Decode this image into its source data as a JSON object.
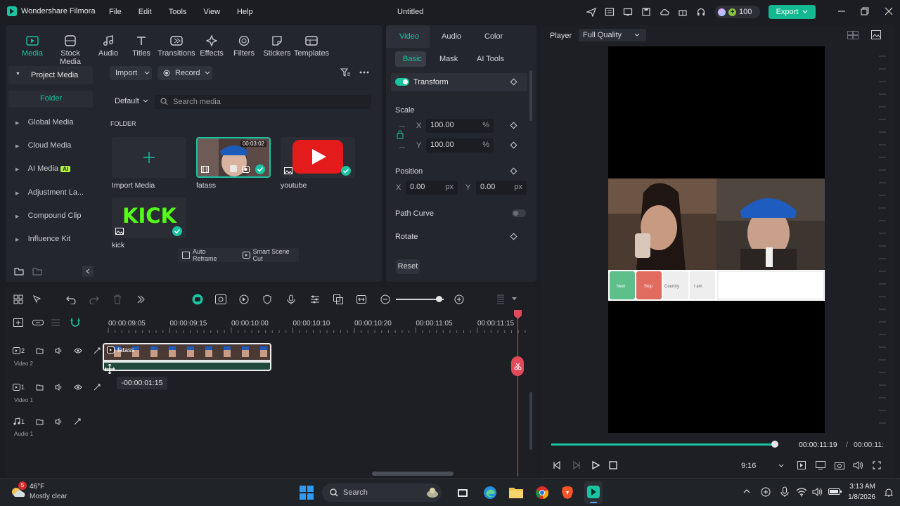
{
  "app": {
    "name": "Wondershare Filmora",
    "title": "Untitled"
  },
  "menu": [
    "File",
    "Edit",
    "Tools",
    "View",
    "Help"
  ],
  "titlebar": {
    "credits": "100",
    "export_label": "Export"
  },
  "toolbar": [
    "Media",
    "Stock Media",
    "Audio",
    "Titles",
    "Transitions",
    "Effects",
    "Filters",
    "Stickers",
    "Templates"
  ],
  "sidebar": {
    "project_media": "Project Media",
    "folder": "Folder",
    "items": [
      "Global Media",
      "Cloud Media",
      "AI Media",
      "Adjustment La...",
      "Compound Clip",
      "Influence Kit"
    ],
    "ai_badge": "AI"
  },
  "media": {
    "import_label": "Import",
    "record_label": "Record",
    "sort_label": "Default",
    "search_placeholder": "Search media",
    "folder_heading": "FOLDER",
    "items": [
      {
        "name": "Import Media"
      },
      {
        "name": "fatass",
        "duration": "00:03:02"
      },
      {
        "name": "youtube"
      },
      {
        "name": "kick"
      }
    ],
    "kick_text": "KICK",
    "auto_reframe": "Auto Reframe",
    "smart_scene_cut": "Smart Scene Cut"
  },
  "props": {
    "tabs": [
      "Video",
      "Audio",
      "Color"
    ],
    "subtabs": [
      "Basic",
      "Mask",
      "AI Tools"
    ],
    "transform": "Transform",
    "scale": "Scale",
    "scale_x_label": "X",
    "scale_x": "100.00",
    "scale_y_label": "Y",
    "scale_y": "100.00",
    "percent": "%",
    "position": "Position",
    "pos_x_label": "X",
    "pos_x": "0.00",
    "pos_y_label": "Y",
    "pos_y": "0.00",
    "px": "px",
    "path_curve": "Path Curve",
    "rotate": "Rotate",
    "reset": "Reset"
  },
  "player": {
    "label": "Player",
    "quality": "Full Quality",
    "current_time": "00:00:11:19",
    "separator": "/",
    "total_time": "00:00:11:",
    "ratio": "9:16",
    "progress": 0.99,
    "overlay_buttons": [
      "Next",
      "Stop",
      "Country",
      "I am"
    ]
  },
  "timeline": {
    "ruler": [
      "00:00:09:05",
      "00:00:09:15",
      "00:00:10:00",
      "00:00:10:10",
      "00:00:10:20",
      "00:00:11:05",
      "00:00:11:15"
    ],
    "tracks": [
      {
        "num": "2",
        "name": "Video 2"
      },
      {
        "num": "1",
        "name": "Video 1"
      },
      {
        "num": "1",
        "name": "Audio 1"
      }
    ],
    "clip_name": "fatass",
    "tooltip": "-00:00:01:15"
  },
  "taskbar": {
    "temp": "46°F",
    "weather": "Mostly clear",
    "badge": "5",
    "search": "Search",
    "time": "3:13 AM",
    "date": "1/8/2026"
  },
  "colors": {
    "accent": "#19c4a3",
    "export": "#14b890",
    "playhead": "#e24a5a"
  }
}
